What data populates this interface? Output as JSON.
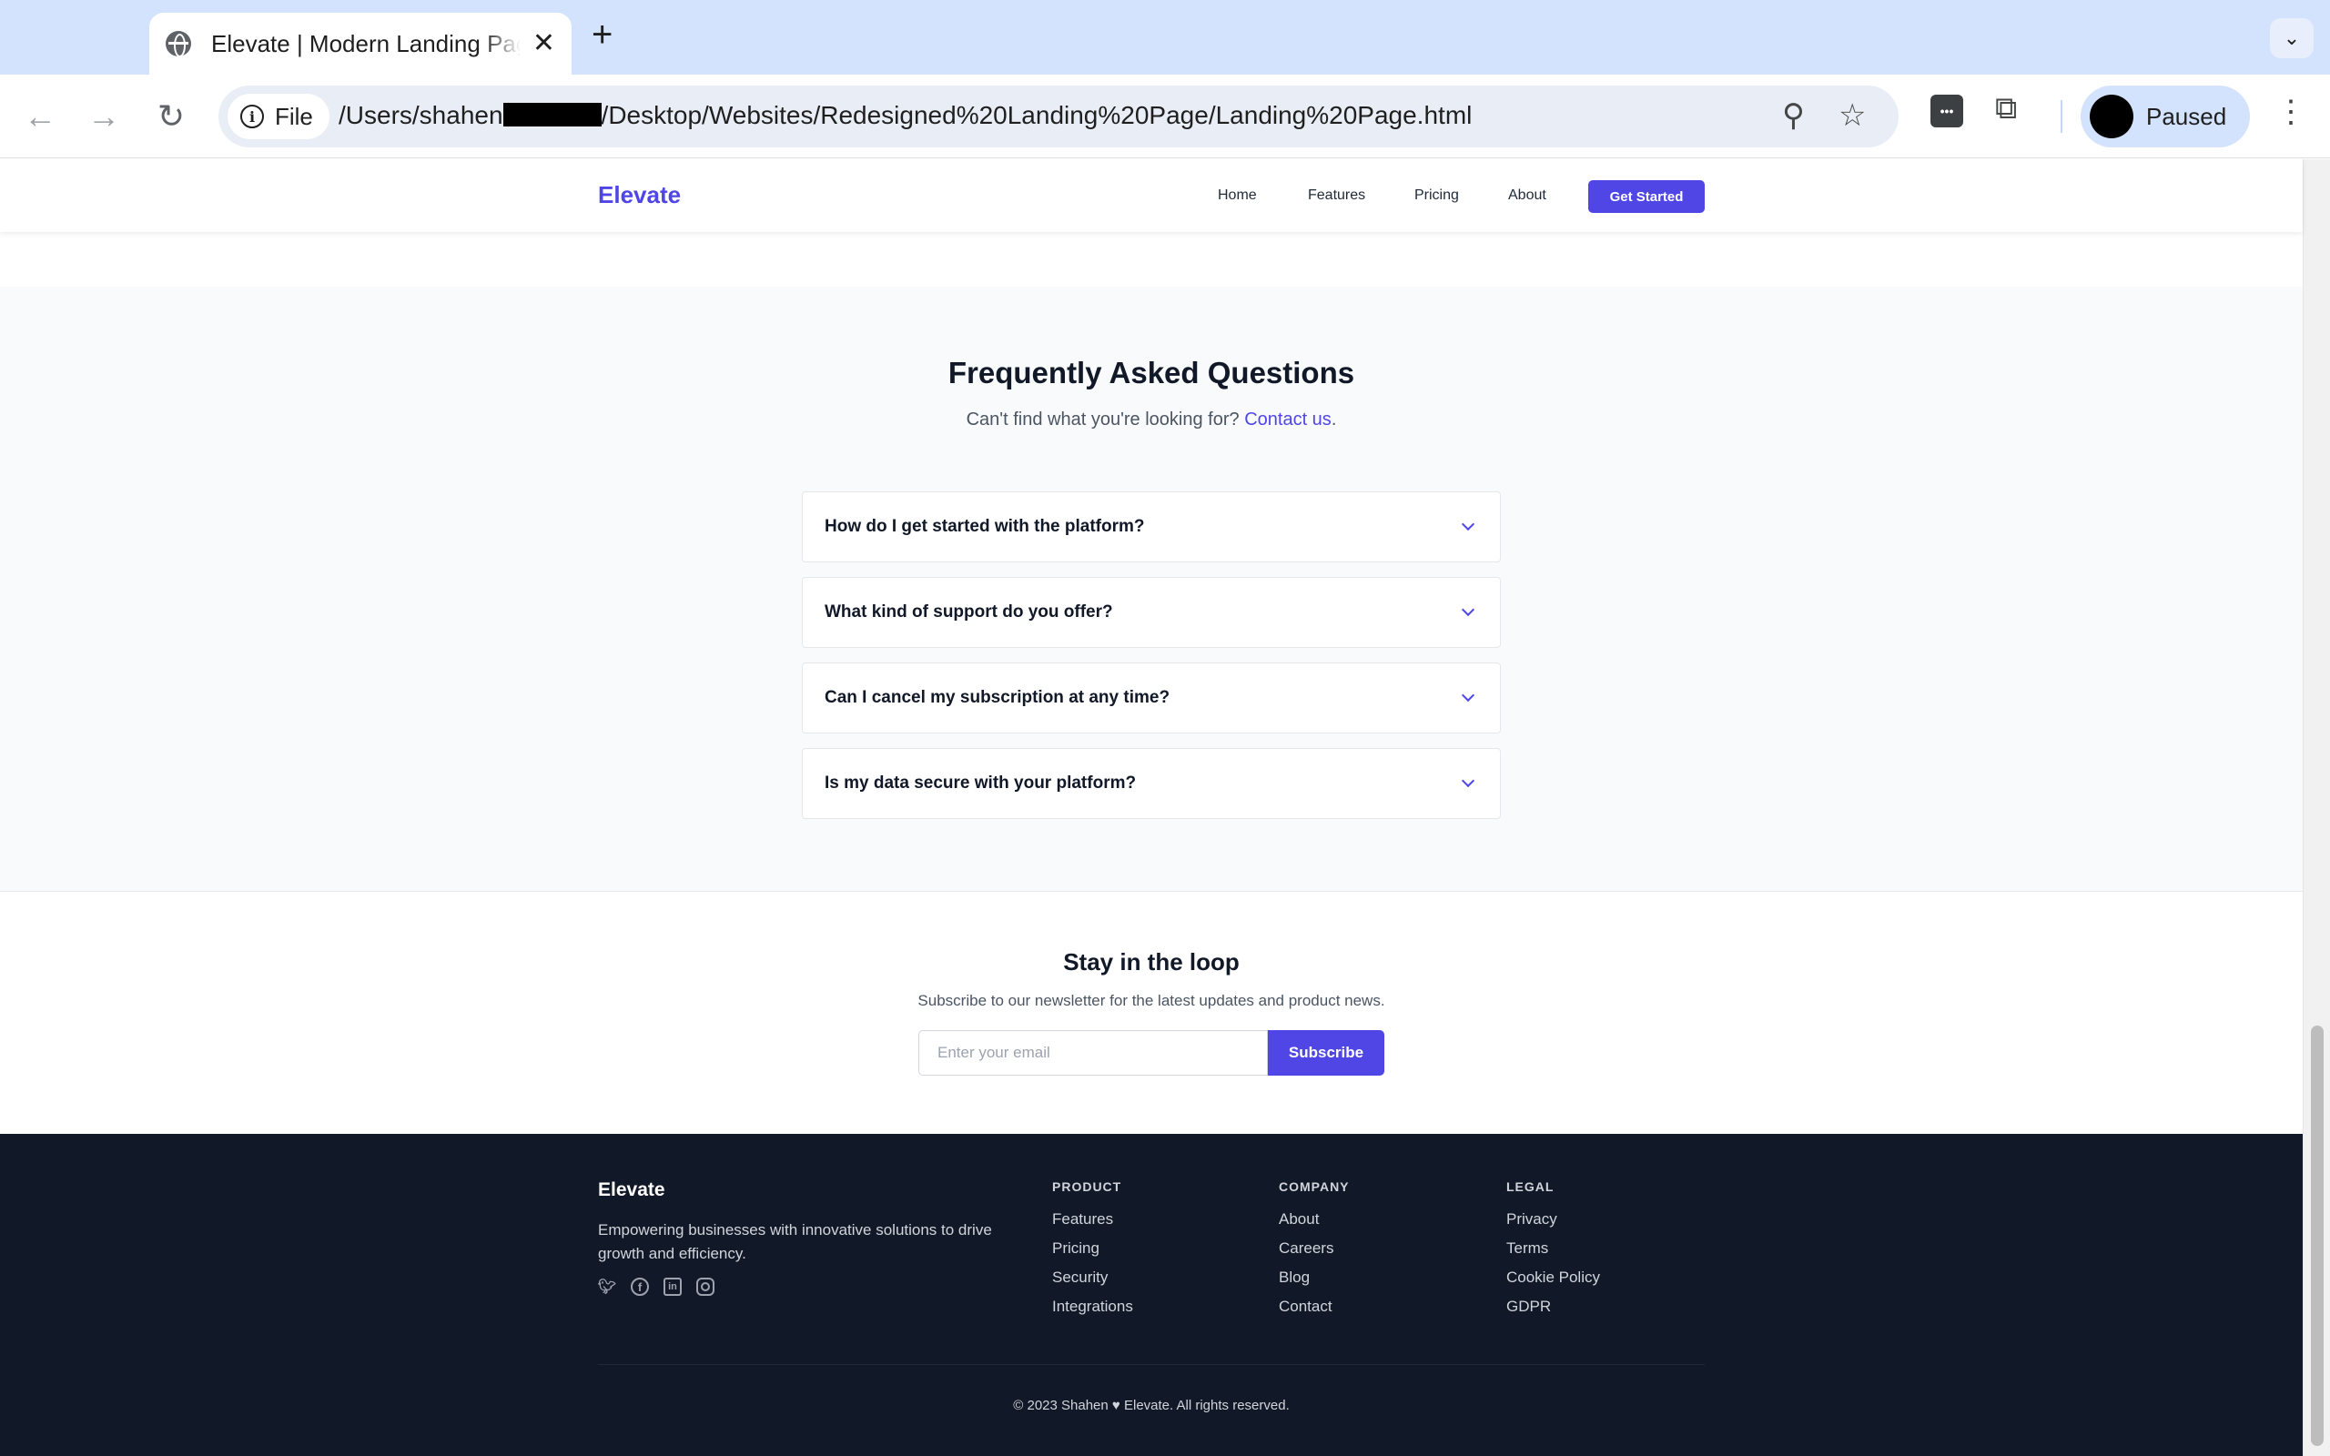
{
  "browser": {
    "tab_title": "Elevate | Modern Landing Page",
    "tab_close": "✕",
    "new_tab": "+",
    "url_chip": "File",
    "url_prefix": "/Users/shahen",
    "url_suffix": "/Desktop/Websites/Redesigned%20Landing%20Page/Landing%20Page.html",
    "profile_status": "Paused"
  },
  "nav": {
    "brand": "Elevate",
    "links": [
      "Home",
      "Features",
      "Pricing",
      "About"
    ],
    "cta": "Get Started"
  },
  "faq": {
    "title": "Frequently Asked Questions",
    "subtitle_prefix": "Can't find what you're looking for?",
    "subtitle_link": "Contact us",
    "subtitle_suffix": ".",
    "items": [
      "How do I get started with the platform?",
      "What kind of support do you offer?",
      "Can I cancel my subscription at any time?",
      "Is my data secure with your platform?"
    ]
  },
  "newsletter": {
    "title": "Stay in the loop",
    "subtitle": "Subscribe to our newsletter for the latest updates and product news.",
    "placeholder": "Enter your email",
    "button": "Subscribe"
  },
  "footer": {
    "brand": "Elevate",
    "description": "Empowering businesses with innovative solutions to drive growth and efficiency.",
    "columns": [
      {
        "heading": "PRODUCT",
        "links": [
          "Features",
          "Pricing",
          "Security",
          "Integrations"
        ]
      },
      {
        "heading": "COMPANY",
        "links": [
          "About",
          "Careers",
          "Blog",
          "Contact"
        ]
      },
      {
        "heading": "LEGAL",
        "links": [
          "Privacy",
          "Terms",
          "Cookie Policy",
          "GDPR"
        ]
      }
    ],
    "copyright": "© 2023 Shahen ♥ Elevate. All rights reserved."
  },
  "icons": {
    "socials": [
      "twitter-icon",
      "facebook-icon",
      "linkedin-icon",
      "instagram-icon"
    ]
  },
  "colors": {
    "accent": "#4f46e5",
    "footer_bg": "#111827",
    "faq_bg": "#f9fafb",
    "chrome_tabbar": "#d3e3fd"
  }
}
